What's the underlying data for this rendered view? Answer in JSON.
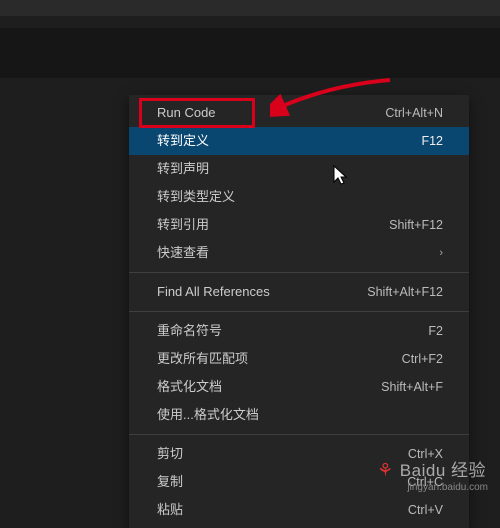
{
  "menu": {
    "items": [
      {
        "label": "Run Code",
        "shortcut": "Ctrl+Alt+N",
        "selected": false,
        "separatorAfter": false
      },
      {
        "label": "转到定义",
        "shortcut": "F12",
        "selected": true,
        "separatorAfter": false
      },
      {
        "label": "转到声明",
        "shortcut": "",
        "selected": false,
        "separatorAfter": false
      },
      {
        "label": "转到类型定义",
        "shortcut": "",
        "selected": false,
        "separatorAfter": false
      },
      {
        "label": "转到引用",
        "shortcut": "Shift+F12",
        "selected": false,
        "separatorAfter": false
      },
      {
        "label": "快速查看",
        "shortcut": "›",
        "selected": false,
        "separatorAfter": true,
        "submenu": true
      },
      {
        "label": "Find All References",
        "shortcut": "Shift+Alt+F12",
        "selected": false,
        "separatorAfter": true
      },
      {
        "label": "重命名符号",
        "shortcut": "F2",
        "selected": false,
        "separatorAfter": false
      },
      {
        "label": "更改所有匹配项",
        "shortcut": "Ctrl+F2",
        "selected": false,
        "separatorAfter": false
      },
      {
        "label": "格式化文档",
        "shortcut": "Shift+Alt+F",
        "selected": false,
        "separatorAfter": false
      },
      {
        "label": "使用...格式化文档",
        "shortcut": "",
        "selected": false,
        "separatorAfter": true
      },
      {
        "label": "剪切",
        "shortcut": "Ctrl+X",
        "selected": false,
        "separatorAfter": false
      },
      {
        "label": "复制",
        "shortcut": "Ctrl+C",
        "selected": false,
        "separatorAfter": false
      },
      {
        "label": "粘贴",
        "shortcut": "Ctrl+V",
        "selected": false,
        "separatorAfter": false
      }
    ]
  },
  "annotation": {
    "highlight_target": "Run Code",
    "arrow_color": "#d9001b"
  },
  "watermark": {
    "brand": "Baidu 经验",
    "sub": "jingyan.baidu.com"
  }
}
